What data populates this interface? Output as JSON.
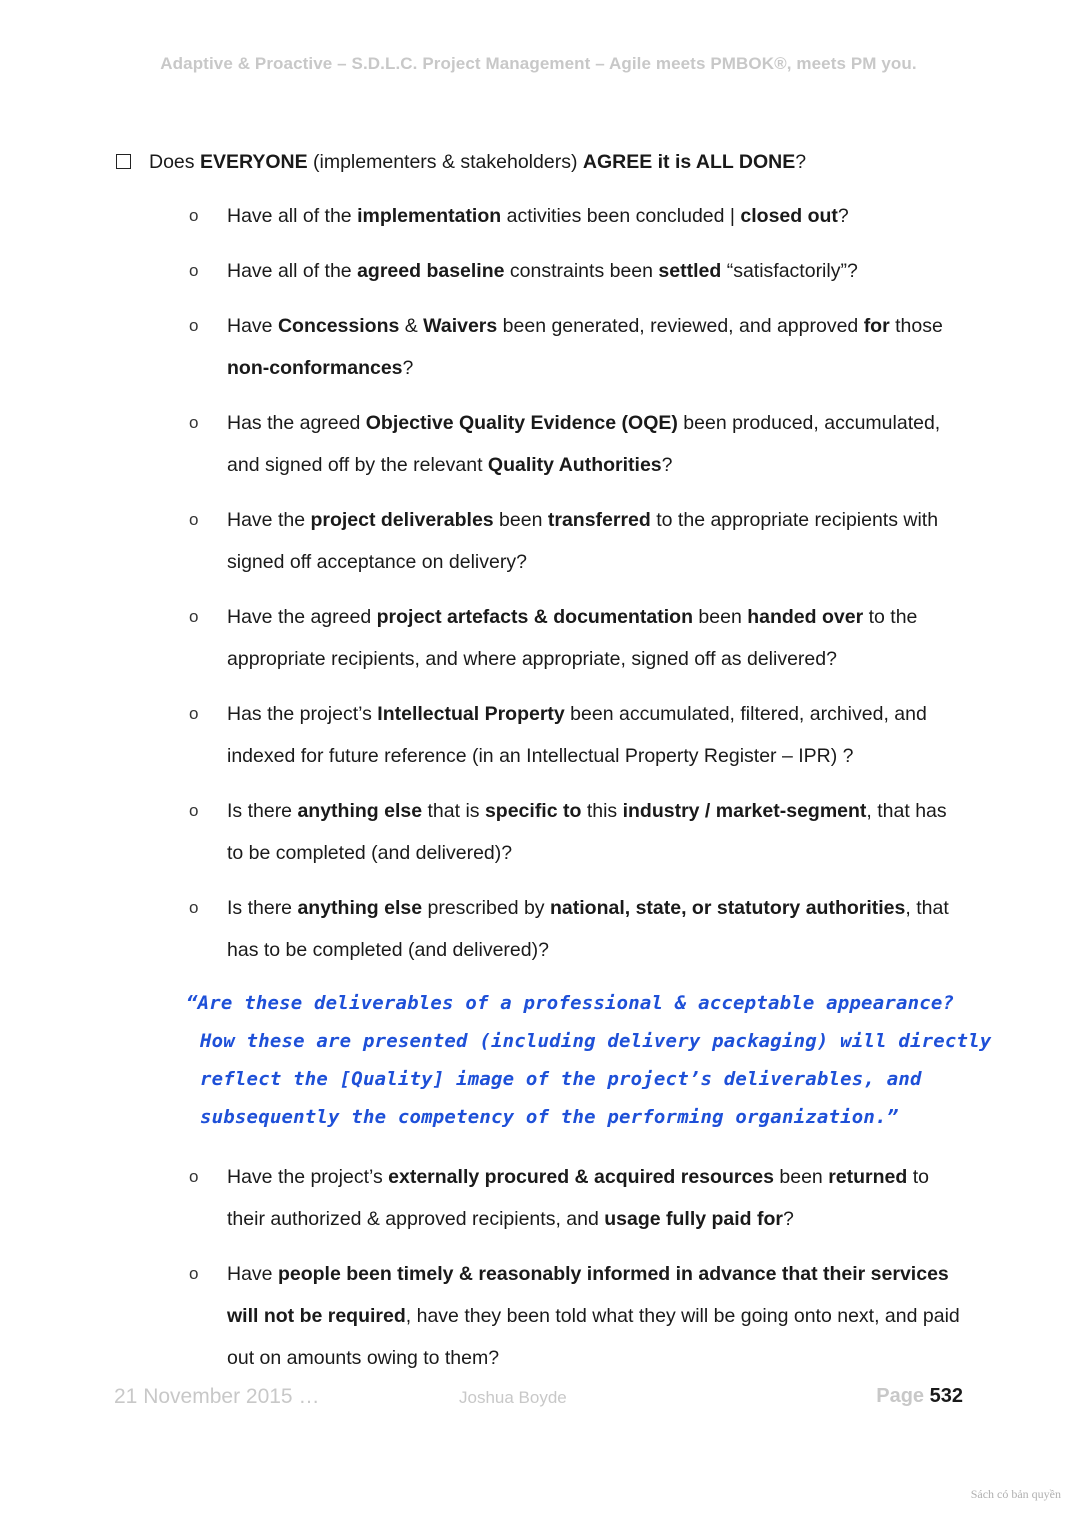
{
  "header": {
    "title": "Adaptive & Proactive – S.D.L.C. Project Management – Agile meets PMBOK®, meets PM you."
  },
  "checklist": {
    "main": [
      {
        "t": "Does ",
        "b": false
      },
      {
        "t": "EVERYONE",
        "b": true
      },
      {
        "t": " (implementers & stakeholders) ",
        "b": false
      },
      {
        "t": "AGREE it is ALL DONE",
        "b": true
      },
      {
        "t": "?",
        "b": false
      }
    ],
    "bullet_glyph": "o",
    "items_before": [
      [
        {
          "t": "Have all of the ",
          "b": false
        },
        {
          "t": "implementation",
          "b": true
        },
        {
          "t": " activities been concluded | ",
          "b": false
        },
        {
          "t": "closed out",
          "b": true
        },
        {
          "t": "?",
          "b": false
        }
      ],
      [
        {
          "t": "Have all of the ",
          "b": false
        },
        {
          "t": "agreed baseline",
          "b": true
        },
        {
          "t": " constraints been ",
          "b": false
        },
        {
          "t": "settled",
          "b": true
        },
        {
          "t": " “satisfactorily”?",
          "b": false
        }
      ],
      [
        {
          "t": "Have ",
          "b": false
        },
        {
          "t": "Concessions",
          "b": true
        },
        {
          "t": " & ",
          "b": false
        },
        {
          "t": "Waivers",
          "b": true
        },
        {
          "t": " been generated, reviewed, and approved ",
          "b": false
        },
        {
          "t": "for",
          "b": true
        },
        {
          "t": " those ",
          "b": false
        },
        {
          "t": "non-conformances",
          "b": true
        },
        {
          "t": "?",
          "b": false
        }
      ],
      [
        {
          "t": "Has the agreed ",
          "b": false
        },
        {
          "t": "Objective Quality Evidence (OQE)",
          "b": true
        },
        {
          "t": " been produced, accumulated, and signed off by the relevant ",
          "b": false
        },
        {
          "t": "Quality Authorities",
          "b": true
        },
        {
          "t": "?",
          "b": false
        }
      ],
      [
        {
          "t": "Have the ",
          "b": false
        },
        {
          "t": "project deliverables",
          "b": true
        },
        {
          "t": " been ",
          "b": false
        },
        {
          "t": "transferred",
          "b": true
        },
        {
          "t": " to the appropriate recipients with signed off acceptance on delivery?",
          "b": false
        }
      ],
      [
        {
          "t": "Have the agreed ",
          "b": false
        },
        {
          "t": "project artefacts & documentation",
          "b": true
        },
        {
          "t": " been ",
          "b": false
        },
        {
          "t": "handed over",
          "b": true
        },
        {
          "t": " to the appropriate recipients, and where appropriate, signed off as delivered?",
          "b": false
        }
      ],
      [
        {
          "t": "Has the project’s ",
          "b": false
        },
        {
          "t": "Intellectual Property",
          "b": true
        },
        {
          "t": " been accumulated, filtered, archived, and indexed for future reference (in an Intellectual Property Register – IPR) ?",
          "b": false
        }
      ],
      [
        {
          "t": "Is there ",
          "b": false
        },
        {
          "t": "anything else",
          "b": true
        },
        {
          "t": " that is ",
          "b": false
        },
        {
          "t": "specific to",
          "b": true
        },
        {
          "t": " this ",
          "b": false
        },
        {
          "t": "industry / market-segment",
          "b": true
        },
        {
          "t": ", that has to be completed (and delivered)?",
          "b": false
        }
      ],
      [
        {
          "t": "Is there ",
          "b": false
        },
        {
          "t": "anything else",
          "b": true
        },
        {
          "t": " prescribed by ",
          "b": false
        },
        {
          "t": "national, state, or statutory authorities",
          "b": true
        },
        {
          "t": ", that has to be completed (and delivered)?",
          "b": false
        }
      ]
    ],
    "items_after": [
      [
        {
          "t": "Have the project’s ",
          "b": false
        },
        {
          "t": "externally procured & acquired resources",
          "b": true
        },
        {
          "t": " been ",
          "b": false
        },
        {
          "t": "returned",
          "b": true
        },
        {
          "t": " to their authorized & approved recipients, and ",
          "b": false
        },
        {
          "t": "usage fully paid for",
          "b": true
        },
        {
          "t": "?",
          "b": false
        }
      ],
      [
        {
          "t": "Have ",
          "b": false
        },
        {
          "t": "people been timely & reasonably informed in advance that their services will not be required",
          "b": true
        },
        {
          "t": ", have they been told what they will be going onto next, and paid out on amounts owing to them?",
          "b": false
        }
      ]
    ]
  },
  "quote": {
    "lines": [
      "“Are these deliverables of a professional & acceptable appearance?",
      "How these are presented (including delivery packaging) will directly",
      "reflect the [Quality] image of the project’s deliverables, and",
      "subsequently the competency of the performing organization.”"
    ]
  },
  "footer": {
    "date": "21 November 2015 …",
    "author": "Joshua Boyde",
    "page_label": "Page",
    "page_number": "532"
  },
  "watermark": "Sách có bản quyền",
  "colors": {
    "quote": "#1e50d8",
    "muted": "#c8c8c8"
  }
}
